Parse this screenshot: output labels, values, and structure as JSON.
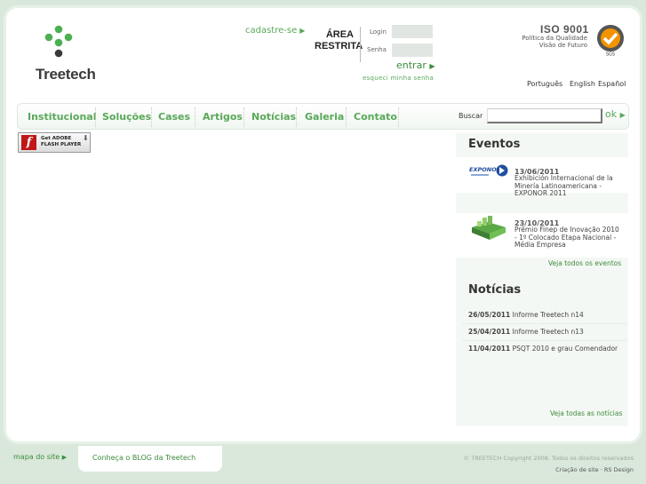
{
  "brand": {
    "name": "Treetech"
  },
  "header": {
    "cadastre": "cadastre-se",
    "area_restrita": "ÁREA RESTRITA",
    "login_label": "Login",
    "senha_label": "Senha",
    "entrar": "entrar",
    "esqueci": "esqueci minha senha",
    "iso_title": "ISO 9001",
    "iso_line1": "Política da Qualidade",
    "iso_line2": "Visão de Futuro",
    "badge_text": "SGS",
    "languages": [
      "Português",
      "English",
      "Español"
    ]
  },
  "nav": {
    "items": [
      "Institucional",
      "Soluções",
      "Cases",
      "Artigos",
      "Notícias",
      "Galeria",
      "Contato"
    ],
    "buscar_label": "Buscar",
    "ok_label": "ok"
  },
  "flash": {
    "line1": "Get ADOBE",
    "line2": "FLASH PLAYER"
  },
  "eventos": {
    "title": "Eventos",
    "items": [
      {
        "date": "13/06/2011",
        "text": "Exhibición Internacional de la Minería Latinoamericana - EXPONOR 2011",
        "logo_text": "EXPONOR"
      },
      {
        "date": "23/10/2011",
        "text": "Prêmio Finep de Inovação 2010 - 1º Colocado Etapa Nacional - Média Empresa"
      }
    ],
    "more": "Veja todos os eventos"
  },
  "noticias": {
    "title": "Notícias",
    "items": [
      {
        "date": "26/05/2011",
        "text": "Informe Treetech n14"
      },
      {
        "date": "25/04/2011",
        "text": "Informe Treetech n13"
      },
      {
        "date": "11/04/2011",
        "text": "PSQT 2010 e grau Comendador"
      }
    ],
    "more": "Veja todas as notícias"
  },
  "footer": {
    "mapa": "mapa do site",
    "blog": "Conheça o BLOG da Treetech",
    "copyright": "© TREETECH Copyright 2008. Todos os direitos reservados",
    "credits": "Criação de site · RS Design"
  },
  "colors": {
    "accent": "#5aa85a",
    "accent_dark": "#3d8b3d",
    "page_bg": "#d9e8da"
  }
}
